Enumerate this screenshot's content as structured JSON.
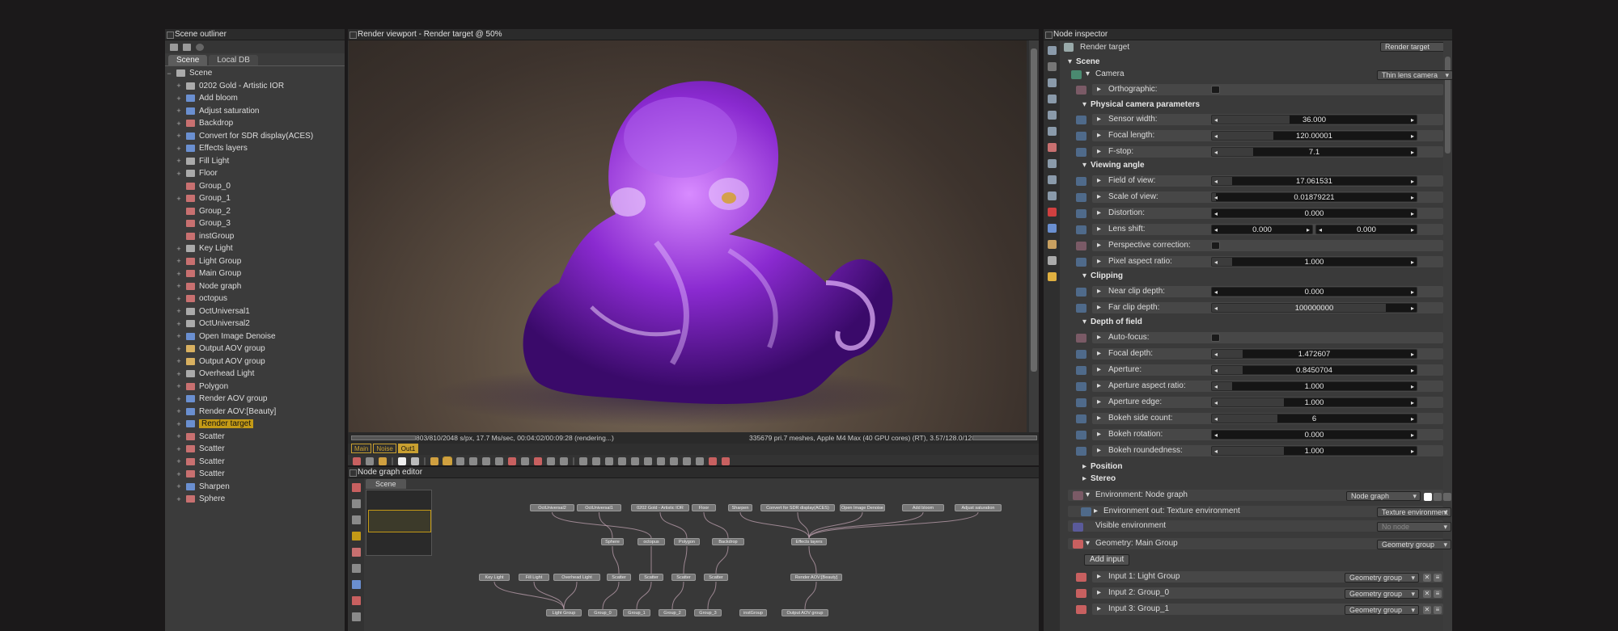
{
  "outliner": {
    "title": "Scene outliner",
    "tabs": [
      "Scene",
      "Local DB"
    ],
    "root": "Scene",
    "items": [
      {
        "label": "0202 Gold - Artistic IOR",
        "icon": "material-icon",
        "color": "#aaaaaa",
        "exp": "+"
      },
      {
        "label": "Add bloom",
        "icon": "image-effect-icon",
        "color": "#6a8fd0",
        "exp": "+"
      },
      {
        "label": "Adjust saturation",
        "icon": "image-effect-icon",
        "color": "#6a8fd0",
        "exp": "+"
      },
      {
        "label": "Backdrop",
        "icon": "geometry-icon",
        "color": "#c87070",
        "exp": "+"
      },
      {
        "label": "Convert for SDR display(ACES)",
        "icon": "image-effect-icon",
        "color": "#6a8fd0",
        "exp": "+"
      },
      {
        "label": "Effects layers",
        "icon": "image-effect-icon",
        "color": "#6a8fd0",
        "exp": "+"
      },
      {
        "label": "Fill Light",
        "icon": "graph-icon",
        "color": "#aaaaaa",
        "exp": "+"
      },
      {
        "label": "Floor",
        "icon": "graph-icon",
        "color": "#aaaaaa",
        "exp": "+"
      },
      {
        "label": "Group_0",
        "icon": "geometry-icon",
        "color": "#c87070",
        "exp": ""
      },
      {
        "label": "Group_1",
        "icon": "geometry-icon",
        "color": "#c87070",
        "exp": "+"
      },
      {
        "label": "Group_2",
        "icon": "geometry-icon",
        "color": "#c87070",
        "exp": ""
      },
      {
        "label": "Group_3",
        "icon": "geometry-icon",
        "color": "#c87070",
        "exp": ""
      },
      {
        "label": "instGroup",
        "icon": "geometry-icon",
        "color": "#c87070",
        "exp": ""
      },
      {
        "label": "Key Light",
        "icon": "graph-icon",
        "color": "#aaaaaa",
        "exp": "+"
      },
      {
        "label": "Light Group",
        "icon": "geometry-icon",
        "color": "#c87070",
        "exp": "+"
      },
      {
        "label": "Main Group",
        "icon": "geometry-icon",
        "color": "#c87070",
        "exp": "+"
      },
      {
        "label": "Node graph",
        "icon": "geometry-icon",
        "color": "#c87070",
        "exp": "+"
      },
      {
        "label": "octopus",
        "icon": "geometry-icon",
        "color": "#c87070",
        "exp": "+"
      },
      {
        "label": "OctUniversal1",
        "icon": "material-icon",
        "color": "#aaaaaa",
        "exp": "+"
      },
      {
        "label": "OctUniversal2",
        "icon": "material-icon",
        "color": "#aaaaaa",
        "exp": "+"
      },
      {
        "label": "Open Image Denoise",
        "icon": "image-effect-icon",
        "color": "#6a8fd0",
        "exp": "+"
      },
      {
        "label": "Output AOV group",
        "icon": "aov-icon",
        "color": "#d8b060",
        "exp": "+"
      },
      {
        "label": "Output AOV group",
        "icon": "aov-icon",
        "color": "#d8b060",
        "exp": "+"
      },
      {
        "label": "Overhead Light",
        "icon": "graph-icon",
        "color": "#aaaaaa",
        "exp": "+"
      },
      {
        "label": "Polygon",
        "icon": "geometry-icon",
        "color": "#c87070",
        "exp": "+"
      },
      {
        "label": "Render AOV group",
        "icon": "image-effect-icon",
        "color": "#6a8fd0",
        "exp": "+"
      },
      {
        "label": "Render AOV:[Beauty]",
        "icon": "image-effect-icon",
        "color": "#6a8fd0",
        "exp": "+"
      },
      {
        "label": "Render target",
        "icon": "render-target-icon",
        "color": "#6a8fd0",
        "exp": "+",
        "selected": true
      },
      {
        "label": "Scatter",
        "icon": "geometry-icon",
        "color": "#c87070",
        "exp": "+"
      },
      {
        "label": "Scatter",
        "icon": "geometry-icon",
        "color": "#c87070",
        "exp": "+"
      },
      {
        "label": "Scatter",
        "icon": "geometry-icon",
        "color": "#c87070",
        "exp": "+"
      },
      {
        "label": "Scatter",
        "icon": "geometry-icon",
        "color": "#c87070",
        "exp": "+"
      },
      {
        "label": "Sharpen",
        "icon": "image-effect-icon",
        "color": "#6a8fd0",
        "exp": "+"
      },
      {
        "label": "Sphere",
        "icon": "geometry-icon",
        "color": "#c87070",
        "exp": "+"
      }
    ],
    "selection_color": "#c49a16"
  },
  "viewport": {
    "title": "Render viewport - Render target @ 50%",
    "status_left": "803/810/2048 s/px, 17.7 Ms/sec, 00:04:02/00:09:28 (rendering...)",
    "status_right": "335679 pri.7 meshes, Apple M4 Max (40 GPU cores) (RT), 3.57/128.0/128.0 GB",
    "tags": [
      "Main",
      "Noise",
      "Out1"
    ],
    "accent": "#c9a030"
  },
  "node_graph": {
    "title": "Node graph editor",
    "tab": "Scene",
    "nodes_row1": [
      "OctUniversal2",
      "OctUniversal1",
      "0202 Gold - Artistic IOR",
      "Floor",
      "Sharpen",
      "Convert for SDR display(ACES)",
      "Open Image Denoise",
      "Add bloom",
      "Adjust saturation"
    ],
    "nodes_row2": [
      "Sphere",
      "octopus",
      "Polygon",
      "Backdrop",
      "Effects layers"
    ],
    "nodes_row3": [
      "Key Light",
      "Fill Light",
      "Overhead Light",
      "Scatter",
      "Scatter",
      "Scatter",
      "Scatter",
      "Render AOV:[Beauty]"
    ],
    "nodes_row4": [
      "Light Group",
      "Group_0",
      "Group_1",
      "Group_2",
      "Group_3",
      "instGroup",
      "Output AOV group"
    ]
  },
  "inspector": {
    "title": "Node inspector",
    "header_label": "Render target",
    "header_dropdown": "Render target",
    "scene_label": "Scene",
    "camera": {
      "label": "Camera",
      "type": "Thin lens camera"
    },
    "orthographic": "Orthographic:",
    "physical_title": "Physical camera parameters",
    "sensor_width": {
      "label": "Sensor width:",
      "value": "36.000",
      "fill": 0.38
    },
    "focal_length": {
      "label": "Focal length:",
      "value": "120.00001",
      "fill": 0.3
    },
    "fstop": {
      "label": "F-stop:",
      "value": "7.1",
      "fill": 0.2
    },
    "viewing_title": "Viewing angle",
    "fov": {
      "label": "Field of view:",
      "value": "17.061531",
      "fill": 0.1
    },
    "scale_of_view": {
      "label": "Scale of view:",
      "value": "0.01879221",
      "fill": 0.02
    },
    "distortion": {
      "label": "Distortion:",
      "value": "0.000",
      "fill": 0
    },
    "lens_shift": {
      "label": "Lens shift:",
      "value_x": "0.000",
      "value_y": "0.000"
    },
    "perspective": "Perspective correction:",
    "pixel_aspect": {
      "label": "Pixel aspect ratio:",
      "value": "1.000",
      "fill": 0.1
    },
    "clipping_title": "Clipping",
    "near_clip": {
      "label": "Near clip depth:",
      "value": "0.000",
      "fill": 0
    },
    "far_clip": {
      "label": "Far clip depth:",
      "value": "100000000",
      "fill": 0.85
    },
    "dof_title": "Depth of field",
    "autofocus": "Auto-focus:",
    "focal_depth": {
      "label": "Focal depth:",
      "value": "1.472607",
      "fill": 0.15
    },
    "aperture": {
      "label": "Aperture:",
      "value": "0.8450704",
      "fill": 0.15
    },
    "aperture_aspect": {
      "label": "Aperture aspect ratio:",
      "value": "1.000",
      "fill": 0.1
    },
    "aperture_edge": {
      "label": "Aperture edge:",
      "value": "1.000",
      "fill": 0.35
    },
    "bokeh_count": {
      "label": "Bokeh side count:",
      "value": "6",
      "fill": 0.32
    },
    "bokeh_rotation": {
      "label": "Bokeh rotation:",
      "value": "0.000",
      "fill": 0
    },
    "bokeh_round": {
      "label": "Bokeh roundedness:",
      "value": "1.000",
      "fill": 0.35
    },
    "position": "Position",
    "stereo": "Stereo",
    "environment": {
      "label": "Environment: Node graph",
      "value": "Node graph"
    },
    "env_out": {
      "label": "Environment out: Texture environment",
      "value": "Texture environment"
    },
    "visible_env": {
      "label": "Visible environment",
      "value": "No node"
    },
    "geometry": {
      "label": "Geometry: Main Group",
      "value": "Geometry group"
    },
    "add_input": "Add input",
    "inputs": [
      {
        "label": "Input 1: Light Group",
        "value": "Geometry group"
      },
      {
        "label": "Input 2: Group_0",
        "value": "Geometry group"
      },
      {
        "label": "Input 3: Group_1",
        "value": "Geometry group"
      }
    ]
  }
}
